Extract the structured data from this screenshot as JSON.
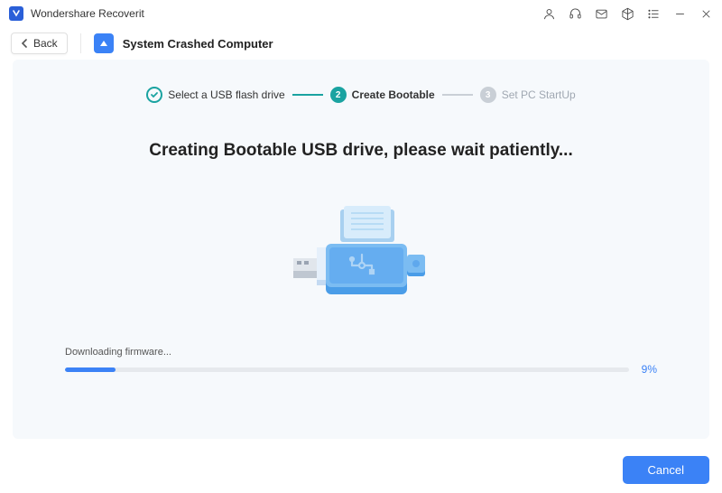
{
  "titlebar": {
    "app_name": "Wondershare Recoverit"
  },
  "nav": {
    "back_label": "Back",
    "page_title": "System Crashed Computer"
  },
  "stepper": {
    "step1": {
      "label": "Select a USB flash drive"
    },
    "step2": {
      "num": "2",
      "label": "Create Bootable"
    },
    "step3": {
      "num": "3",
      "label": "Set PC StartUp"
    }
  },
  "main": {
    "heading": "Creating Bootable USB drive, please wait patiently...",
    "status_text": "Downloading firmware...",
    "progress_percent": 9,
    "progress_label": "9%"
  },
  "footer": {
    "cancel_label": "Cancel"
  },
  "colors": {
    "accent_blue": "#3b82f6",
    "accent_teal": "#1aa3a1"
  }
}
